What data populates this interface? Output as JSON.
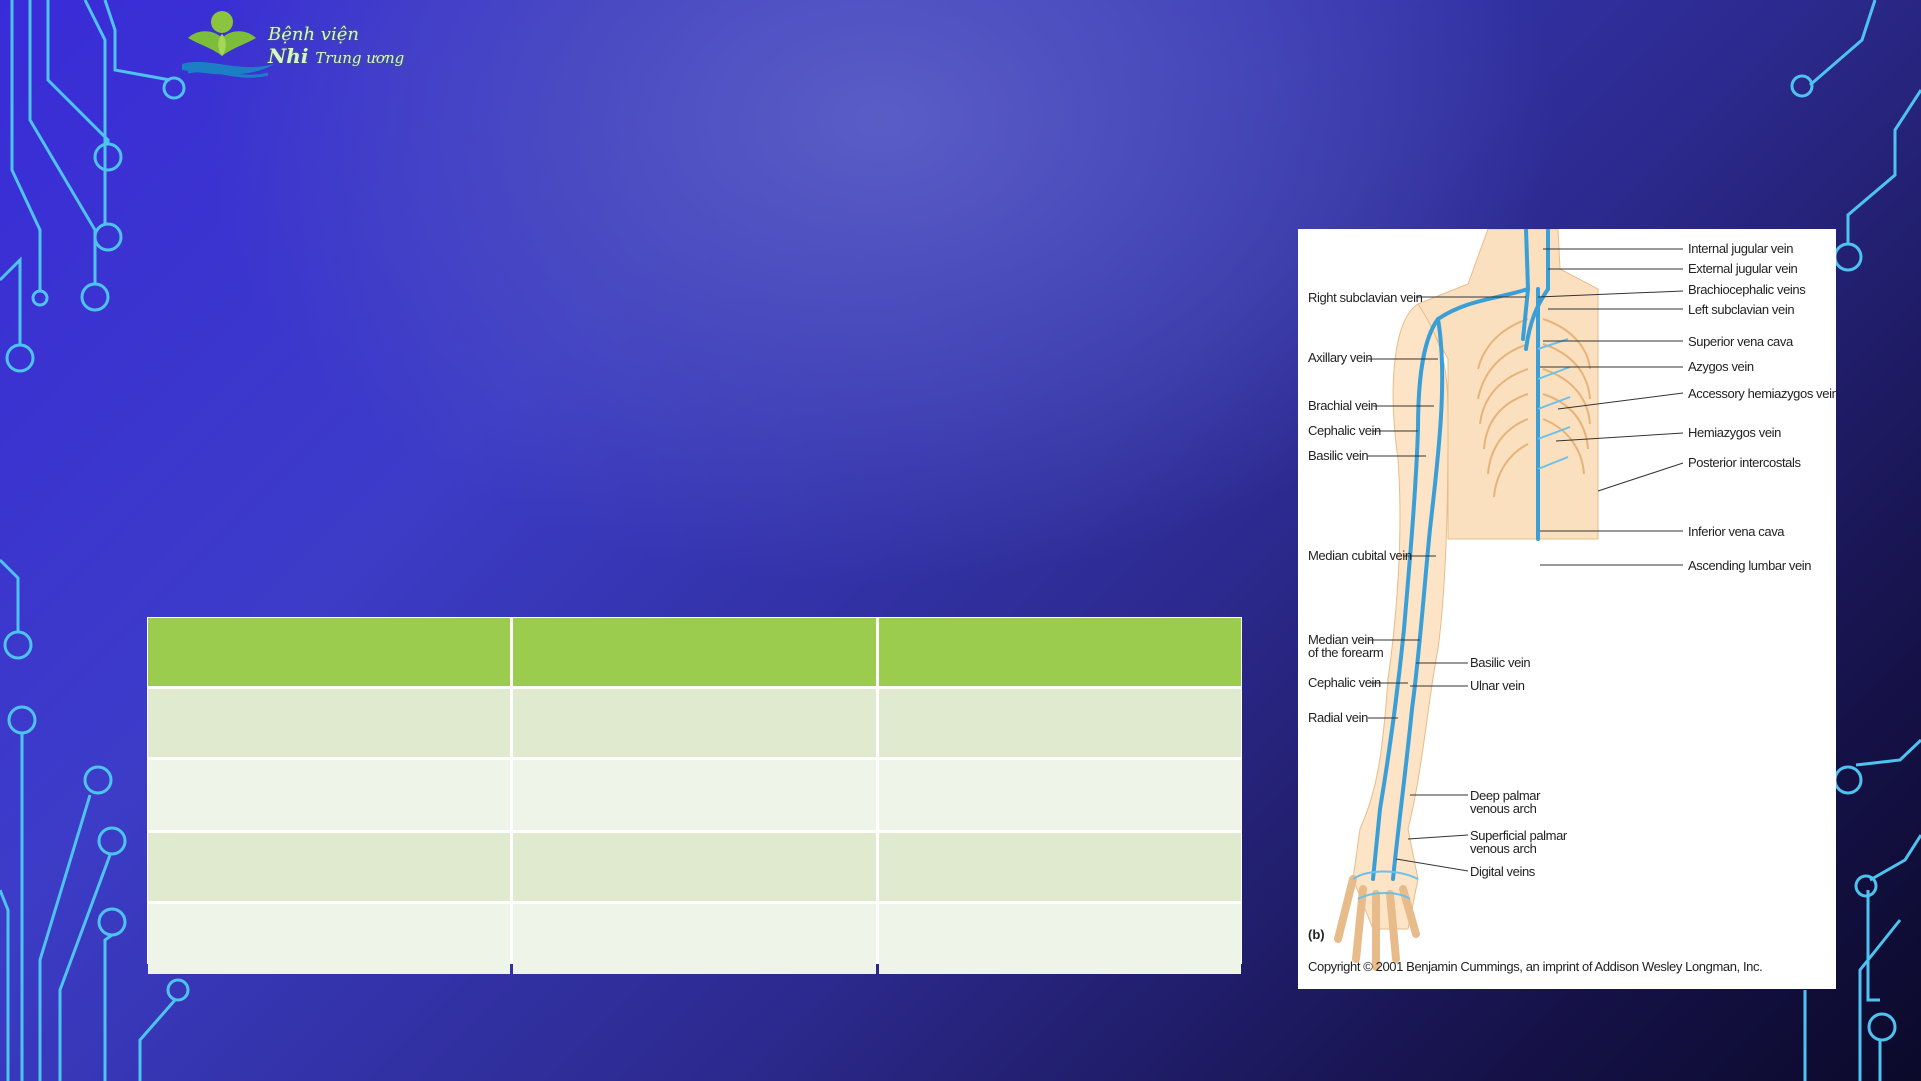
{
  "logo": {
    "line1": "Bệnh viện",
    "line2_bold": "Nhi",
    "line2_rest": "Trung ương"
  },
  "table": {
    "headers": [
      "",
      "",
      ""
    ],
    "rows": [
      [
        "",
        "",
        ""
      ],
      [
        "",
        "",
        ""
      ],
      [
        "",
        "",
        ""
      ],
      [
        "",
        "",
        ""
      ]
    ]
  },
  "figure": {
    "panel_label": "(b)",
    "copyright": "Copyright © 2001 Benjamin Cummings, an imprint of Addison Wesley Longman, Inc.",
    "right_labels": {
      "internal_jugular": "Internal jugular vein",
      "external_jugular": "External jugular vein",
      "brachiocephalic": "Brachiocephalic veins",
      "left_subclavian": "Left subclavian vein",
      "superior_vena_cava": "Superior vena cava",
      "azygos": "Azygos vein",
      "accessory_hemiazygos": "Accessory hemiazygos vein",
      "hemiazygos": "Hemiazygos vein",
      "posterior_intercostals": "Posterior intercostals",
      "inferior_vena_cava": "Inferior vena cava",
      "ascending_lumbar": "Ascending lumbar vein"
    },
    "left_labels": {
      "right_subclavian": "Right subclavian vein",
      "axillary": "Axillary vein",
      "brachial": "Brachial vein",
      "cephalic_upper": "Cephalic vein",
      "basilic_upper": "Basilic vein",
      "median_cubital": "Median cubital vein",
      "median_forearm_1": "Median vein",
      "median_forearm_2": "of the forearm",
      "cephalic_lower": "Cephalic vein",
      "radial": "Radial vein"
    },
    "mid_labels": {
      "basilic_lower": "Basilic vein",
      "ulnar": "Ulnar vein",
      "deep_palmar_1": "Deep palmar",
      "deep_palmar_2": "venous arch",
      "superficial_palmar_1": "Superficial palmar",
      "superficial_palmar_2": "venous arch",
      "digital": "Digital veins"
    }
  },
  "colors": {
    "table_header": "#9bcc4e",
    "table_row_odd": "#dfeacf",
    "table_row_even": "#eff4e8",
    "circuit": "#4ec3f0",
    "vein": "#3a9fd6"
  }
}
